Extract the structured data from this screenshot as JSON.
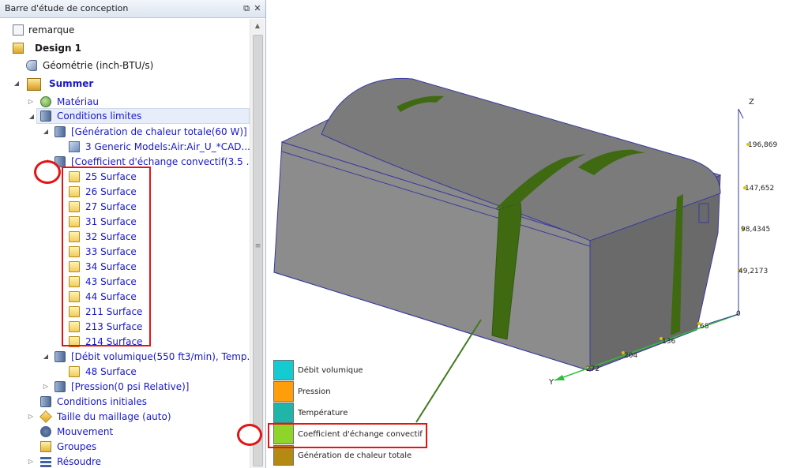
{
  "panel": {
    "title": "Barre d'étude de conception",
    "pin_icon": "pin-icon",
    "close_icon": "close-icon"
  },
  "tree": {
    "remarque": "remarque",
    "design": "Design 1",
    "geometry": "Géométrie (inch-BTU/s)",
    "scenario": "Summer",
    "material": "Matériau",
    "boundary_conditions": "Conditions limites",
    "heat_generation": "[Génération de chaleur totale(60 W)]",
    "generic_models": "3 Generic Models:Air:Air_U_*CAD...",
    "convection": "[Coefficient d'échange convectif(3.5 ...",
    "surfaces": [
      "25 Surface",
      "26 Surface",
      "27 Surface",
      "31 Surface",
      "32 Surface",
      "33 Surface",
      "34 Surface",
      "43 Surface",
      "44 Surface",
      "211 Surface",
      "213 Surface",
      "214 Surface"
    ],
    "volume_flow": "[Débit volumique(550 ft3/min), Temp...",
    "volume_flow_surface": "48 Surface",
    "pressure": "[Pression(0 psi Relative)]",
    "initial_conditions": "Conditions initiales",
    "mesh_size": "Taille du maillage (auto)",
    "motion": "Mouvement",
    "groups": "Groupes",
    "solve": "Résoudre"
  },
  "axes": {
    "z_label": "Z",
    "y_label": "Y",
    "z_ticks": [
      "196,869",
      "147,652",
      "98,4345",
      "49,2173"
    ],
    "y_ticks": [
      "0",
      "68",
      "136",
      "204",
      "272"
    ]
  },
  "legend": [
    {
      "label": "Débit volumique",
      "color": "#14cbd2"
    },
    {
      "label": "Pression",
      "color": "#ff9e0b"
    },
    {
      "label": "Température",
      "color": "#1fb5a8"
    },
    {
      "label": "Coefficient d'échange convectif",
      "color": "#8ed42a"
    },
    {
      "label": "Génération de chaleur totale",
      "color": "#b58a13"
    }
  ],
  "colors": {
    "model_body": "#7a7a7a",
    "model_edge": "#3a3aa0",
    "band_green": "#3f6a12",
    "annotation_red": "#e51414",
    "link_line": "#3f7a1e"
  }
}
